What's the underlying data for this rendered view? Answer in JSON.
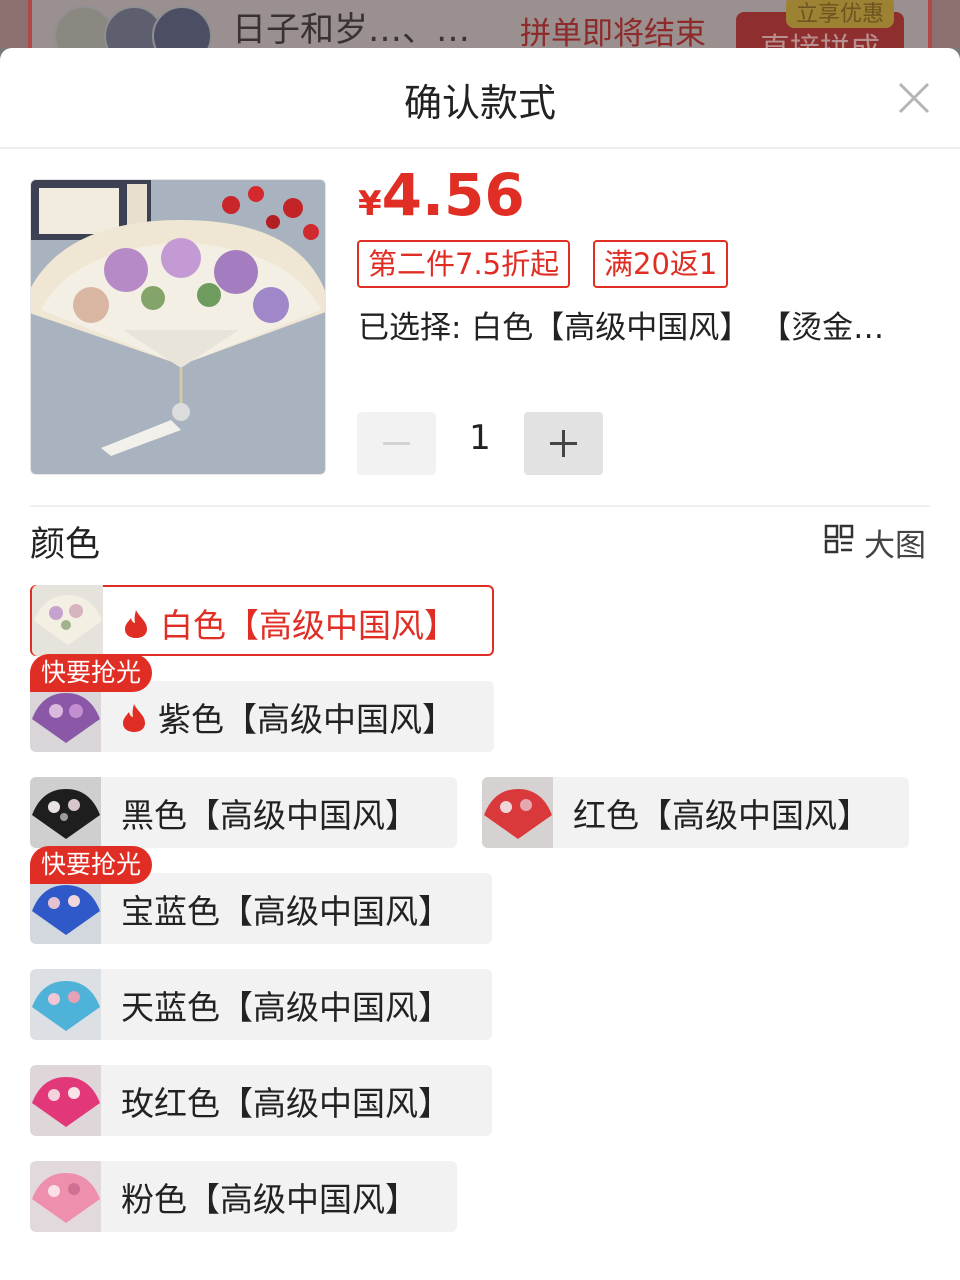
{
  "background": {
    "username": "日子和岁…、…",
    "ending_text": "拼单即将结束",
    "join_button": "直接拼成",
    "discount_badge": "立享优惠"
  },
  "sheet": {
    "title": "确认款式",
    "close_icon": "close-icon"
  },
  "product": {
    "currency": "¥",
    "price": "4.56",
    "tags": [
      "第二件7.5折起",
      "满20返1"
    ],
    "selected_text": "已选择: 白色【高级中国风】 【烫金…",
    "quantity": "1"
  },
  "spec": {
    "label": "颜色",
    "big_picture_label": "大图",
    "options": [
      {
        "label": "白色【高级中国风】",
        "selected": true,
        "hot": true,
        "badge": ""
      },
      {
        "label": "紫色【高级中国风】",
        "selected": false,
        "hot": true,
        "badge": "快要抢光"
      },
      {
        "label": "黑色【高级中国风】",
        "selected": false,
        "hot": false,
        "badge": ""
      },
      {
        "label": "红色【高级中国风】",
        "selected": false,
        "hot": false,
        "badge": ""
      },
      {
        "label": "宝蓝色【高级中国风】",
        "selected": false,
        "hot": false,
        "badge": "快要抢光"
      },
      {
        "label": "天蓝色【高级中国风】",
        "selected": false,
        "hot": false,
        "badge": ""
      },
      {
        "label": "玫红色【高级中国风】",
        "selected": false,
        "hot": false,
        "badge": ""
      },
      {
        "label": "粉色【高级中国风】",
        "selected": false,
        "hot": false,
        "badge": ""
      }
    ]
  },
  "colors": {
    "accent": "#e02e24",
    "option_bg": "#f2f2f2"
  }
}
